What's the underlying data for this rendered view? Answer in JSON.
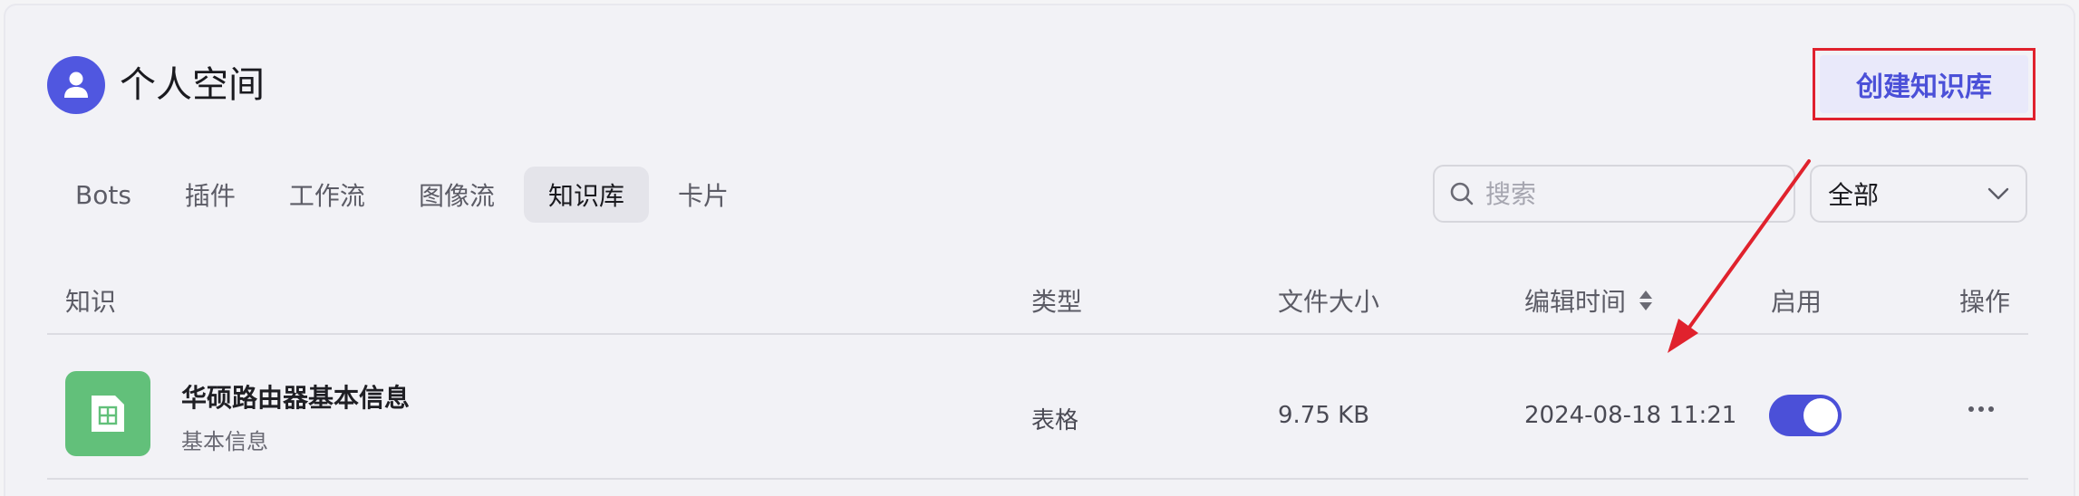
{
  "header": {
    "title": "个人空间",
    "avatar_icon": "user-icon",
    "create_button": "创建知识库"
  },
  "tabs": [
    {
      "label": "Bots",
      "active": false
    },
    {
      "label": "插件",
      "active": false
    },
    {
      "label": "工作流",
      "active": false
    },
    {
      "label": "图像流",
      "active": false
    },
    {
      "label": "知识库",
      "active": true
    },
    {
      "label": "卡片",
      "active": false
    }
  ],
  "search": {
    "placeholder": "搜索",
    "value": "",
    "icon": "search-icon"
  },
  "filter": {
    "selected": "全部",
    "icon": "chevron-down-icon"
  },
  "table": {
    "columns": {
      "knowledge": "知识",
      "type": "类型",
      "size": "文件大小",
      "edit_time": "编辑时间",
      "enabled": "启用",
      "actions": "操作"
    },
    "rows": [
      {
        "name": "华硕路由器基本信息",
        "description": "基本信息",
        "icon": "table-icon",
        "type": "表格",
        "size": "9.75 KB",
        "edit_time": "2024-08-18 11:21",
        "enabled": true,
        "actions_icon": "more-icon"
      }
    ]
  },
  "colors": {
    "accent": "#4b50d8",
    "highlight_box": "#e0222d",
    "doc_icon_bg": "#62c07a"
  }
}
